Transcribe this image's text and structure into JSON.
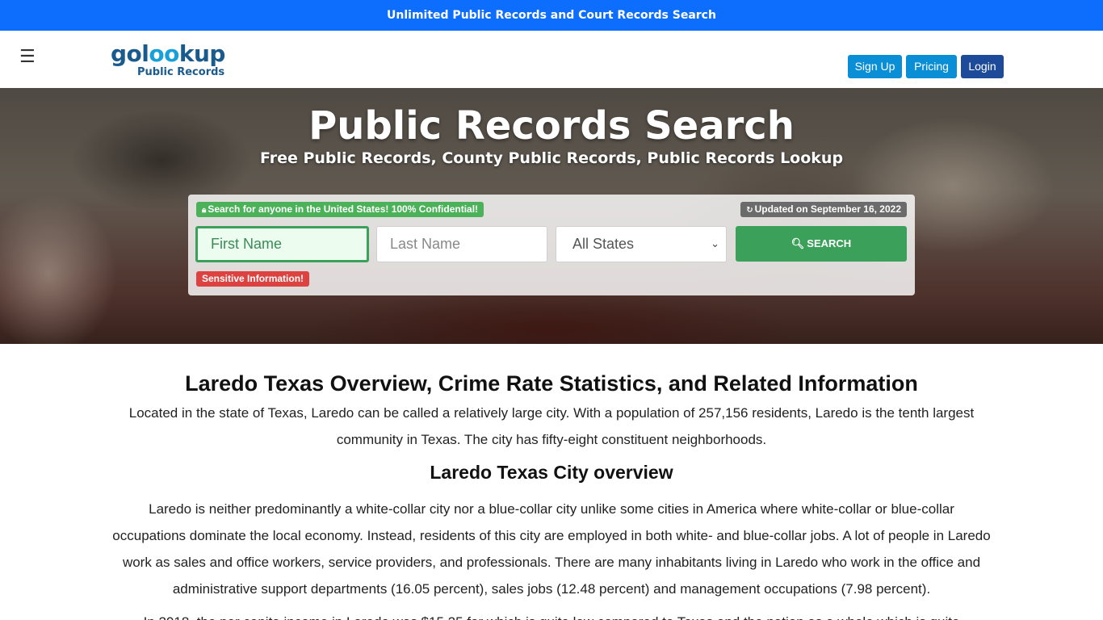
{
  "banner": {
    "text": "Unlimited Public Records and Court Records Search"
  },
  "nav": {
    "menu_icon": "hamburger-menu-icon",
    "logo_prefix": "gol",
    "logo_oo": "oo",
    "logo_suffix": "kup",
    "logo_sub": "Public Records",
    "signup": "Sign Up",
    "pricing": "Pricing",
    "login": "Login"
  },
  "hero": {
    "title": "Public Records Search",
    "subtitle": "Free Public Records, County Public Records, Public Records Lookup"
  },
  "search": {
    "confidential_badge": "Search for anyone in the United States! 100% Confidential!",
    "updated_badge": "Updated on September 16, 2022",
    "first_name_placeholder": "First Name",
    "last_name_placeholder": "Last Name",
    "state_selected": "All States",
    "button_label": "SEARCH",
    "sensitive_badge": "Sensitive Information!"
  },
  "article": {
    "heading": "Laredo Texas Overview, Crime Rate Statistics, and Related Information",
    "intro": "Located in the state of Texas, Laredo can be called a relatively large city. With a population of 257,156 residents, Laredo is the tenth largest community in Texas. The city has fifty-eight constituent neighborhoods.",
    "subheading": "Laredo Texas City overview",
    "body": "Laredo is neither predominantly a white-collar city nor a blue-collar city unlike some cities in America where white-collar or blue-collar occupations dominate the local economy. Instead, residents of this city are employed in both white- and blue-collar jobs. A lot of people in Laredo work as sales and office workers, service providers, and professionals. There are many inhabitants living in Laredo who work in the office and administrative support departments (16.05 percent), sales jobs (12.48 percent) and management occupations (7.98 percent).",
    "body2": "In 2018, the per capita income in Laredo was $15,25 for which is quite low compared to Texas and the nation as a whole which is quite"
  },
  "colors": {
    "banner_bg": "#0d6efd",
    "signup_bg": "#0a8fd6",
    "login_bg": "#1d4b9a",
    "search_green": "#3aa05a",
    "sensitive_red": "#dc4240"
  }
}
